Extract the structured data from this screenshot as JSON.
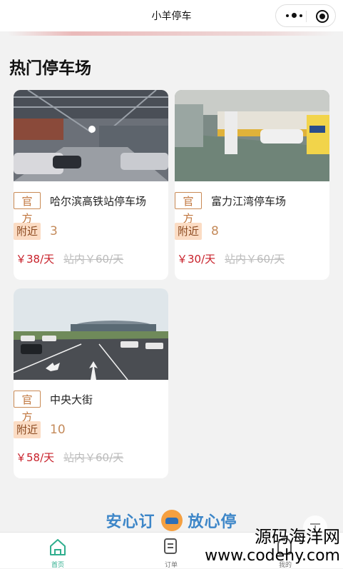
{
  "app": {
    "title": "小羊停车"
  },
  "section": {
    "title": "热门停车场"
  },
  "lots": [
    {
      "tag": "官方",
      "name": "哈尔滨高铁站停车场",
      "near_label": "附近",
      "distance": "3",
      "price": "￥38/天",
      "original": "站内￥60/天",
      "photo": "indoor-garage-photo"
    },
    {
      "tag": "官方",
      "name": "富力江湾停车场",
      "near_label": "附近",
      "distance": "8",
      "price": "￥30/天",
      "original": "站内￥60/天",
      "photo": "underground-garage-photo"
    },
    {
      "tag": "官方",
      "name": "中央大街",
      "near_label": "附近",
      "distance": "10",
      "price": "￥58/天",
      "original": "站内￥60/天",
      "photo": "outdoor-lot-photo"
    }
  ],
  "brand": {
    "left": "安心订",
    "right": "放心停"
  },
  "tabs": [
    {
      "label": "首页",
      "icon": "home-icon",
      "active": true
    },
    {
      "label": "订单",
      "icon": "order-icon",
      "active": false
    },
    {
      "label": "我的",
      "icon": "user-icon",
      "active": false
    }
  ],
  "watermark": {
    "cn": "源码海洋网",
    "en": "www.codehy.com"
  },
  "colors": {
    "accent": "#2fae8e",
    "price": "#c8202a",
    "tag_border": "#c98a55",
    "near_bg": "#fbdcc4",
    "brand_blue": "#3d86c8"
  }
}
